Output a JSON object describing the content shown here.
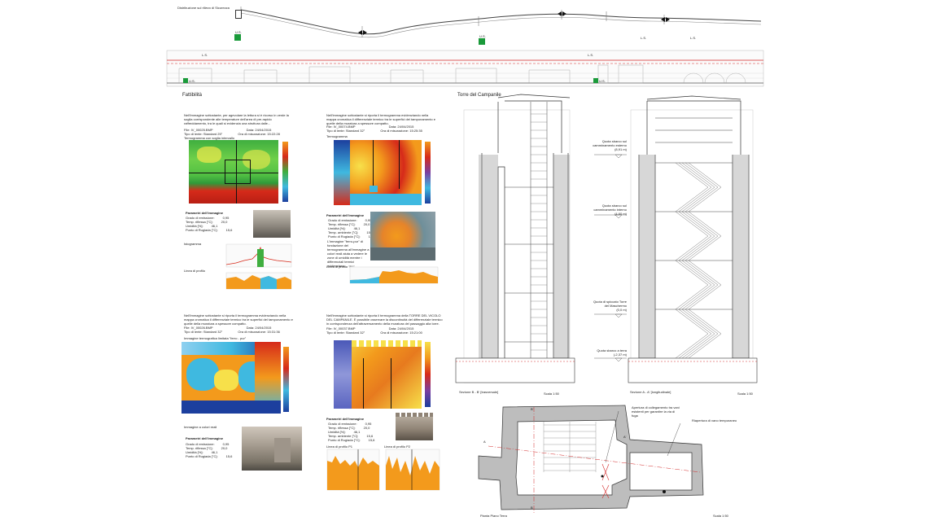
{
  "header": {
    "title": "Distribuzione sul rilievo di Sicurezza",
    "ls_labels": [
      "L.S.",
      "L.S.",
      "L.S.",
      "L.S."
    ],
    "us_labels": [
      "U.S.",
      "U.S.",
      "U.S.",
      "U.S."
    ]
  },
  "sections": {
    "fattibilita": "Fattibilità",
    "torre": "Torre del Campanile"
  },
  "panel1": {
    "intro": "Nell'immagine sottostante, per agevolare la lettura si è ricorso in verde la soglia corrispondente alle temperature dell'area di pre-rapido raffreddamento, tra le quali si evidenzia una struttura dalle...",
    "file_label": "File:",
    "file": "IV_00025.BMP",
    "date_label": "Data:",
    "date": "24/04/2015",
    "lens_label": "Tipo di lente:",
    "lens": "Standard 25°",
    "time_label": "Ora di misurazione:",
    "time": "15:22:28",
    "thermo_title": "Termogramma con soglia intervallo",
    "params_title": "Parametri dell'immagine",
    "params": [
      [
        "Grado di emissione:",
        "0,95"
      ],
      [
        "Temp. riflessa [°C]:",
        "20,0"
      ],
      [
        "Umidità [%]:",
        "46,1"
      ],
      [
        "Punto di Rugiada [°C]:",
        "15,6"
      ]
    ],
    "profile_title": "Istogramma",
    "line_title": "Linea di profilo"
  },
  "panel2": {
    "intro": "Nell'immagine sottostante si riporta il termogramma evidenziando nella mappa cromatica il differenziale termico tra le superfici del tamponamento e quelle della muratura a spessore compatto.",
    "file_label": "File:",
    "file": "IV_00074.BMP",
    "date_label": "Data:",
    "date": "24/04/2015",
    "lens_label": "Tipo di lente:",
    "lens": "Standard 32°",
    "time_label": "Ora di misurazione:",
    "time": "15:25:35",
    "thermo_title": "Termogramma",
    "params_title": "Parametri dell'immagine",
    "params": [
      [
        "Grado di emissione:",
        "0,95"
      ],
      [
        "Temp. riflessa [°C]:",
        "20,0"
      ],
      [
        "Umidità [%]:",
        "46,1"
      ],
      [
        "Temp. ambiente [°C]:",
        "15,6"
      ],
      [
        "Punto di Rugiada [°C]:",
        "15,6"
      ]
    ],
    "note": "L'immagine \"ferro-pur\" di fondazione del termogramma all'immagine a colori reali aiuta a vedere le zone di umidità mentre i differenziali termici evidenziano...",
    "line_title": "Linea di profilo \"P1\""
  },
  "panel3": {
    "intro": "Nell'immagine sottostante si riporta il termogramma evidenziando nella mappa cromatica il differenziale termico tra le superfici del tamponamento e quelle della muratura a spessore compatto.",
    "file_label": "File:",
    "file": "IV_00026.BMP",
    "date_label": "Data:",
    "date": "24/04/2015",
    "lens_label": "Tipo di lente:",
    "lens": "Standard 32°",
    "time_label": "Ora di misurazione:",
    "time": "15:31:36",
    "thermo_title": "Immagine termografica limitata \"ferro - pur\"",
    "photo_title": "Immagine a colori reali",
    "params_title": "Parametri dell'immagine",
    "params": [
      [
        "Grado di emissione:",
        "0,95"
      ],
      [
        "Temp. riflessa [°C]:",
        "20,0"
      ],
      [
        "Umidità [%]:",
        "46,1"
      ],
      [
        "Punto di Rugiada [°C]:",
        "15,6"
      ]
    ]
  },
  "panel4": {
    "intro": "Nell'immagine sottostante si riporta il termogramma della TORRE DEL VICOLO DEL CAMPANILE. È possibile osservare la discontinuità del differenziale termico in corrispondenza dell'attraversamento della muratura del passaggio alla torre.",
    "file_label": "File:",
    "file": "IV_00037.BMP",
    "date_label": "Data:",
    "date": "24/04/2015",
    "lens_label": "Tipo di lente:",
    "lens": "Standard 32°",
    "time_label": "Ora di misurazione:",
    "time": "15:21:00",
    "params_title": "Parametri dell'immagine",
    "params": [
      [
        "Grado di emissione:",
        "0,95"
      ],
      [
        "Temp. riflessa [°C]:",
        "20,0"
      ],
      [
        "Umidità [%]:",
        "46,1"
      ],
      [
        "Temp. ambiente [°C]:",
        "15,6"
      ],
      [
        "Punto di Rugiada [°C]:",
        "15,6"
      ]
    ],
    "p1_title": "Linea di profilo P1",
    "p2_title": "Linea di profilo P2"
  },
  "tower": {
    "section_bb": "Sezione B - B' [trasversale]",
    "section_aa": "Sezione A - A' [longitudinale]",
    "scale_1": "Scala 1:50",
    "scale_2": "Scala 1:50",
    "scale_3": "Scala 1:50",
    "plan": "Pianta Piano Terra",
    "levels": [
      {
        "label": "Quota sbarco sul camminamento esterno",
        "value": "(8,91 m)"
      },
      {
        "label": "Quota sbarco sul camminamento interno",
        "value": "(4,60 m)"
      },
      {
        "label": "Quota di spiccato Torre del Maschermo",
        "value": "(0,0 m)"
      },
      {
        "label": "Quota sbarco a terra",
        "value": "(-2,37 m)"
      }
    ],
    "plan_note_1": "Apertura di collegamento tra vani esistenti per garantire la via di fuga",
    "plan_note_2": "Riapertura di vano temporaneo"
  },
  "colors": {
    "thermal_hot": "#d62a1a",
    "thermal_warm": "#f39a1c",
    "thermal_mid": "#f7e04a",
    "thermal_cool": "#3fb9e0",
    "thermal_cold": "#1c3f9e",
    "green_sign": "#1a9a3a",
    "red_line": "#d42a2a"
  }
}
